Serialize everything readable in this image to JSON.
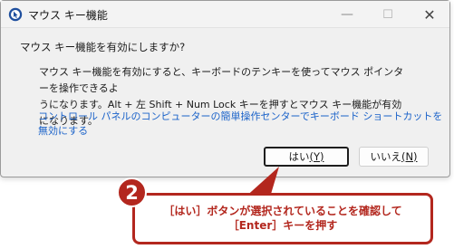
{
  "window": {
    "title": "マウス キー機能",
    "controls": {
      "minimize": "—",
      "maximize": "☐",
      "close": "✕"
    },
    "icon": "mouse-keys-app-icon"
  },
  "dialog": {
    "question": "マウス キー機能を有効にしますか?",
    "description": "マウス キー機能を有効にすると、キーボードのテンキーを使ってマウス ポインターを操作できるよ\nうになります。Alt + 左 Shift + Num Lock キーを押すとマウス キー機能が有効になります。",
    "link": "コントロール パネルのコンピューターの簡単操作センターでキーボード ショートカットを無効にする",
    "buttons": {
      "yes": {
        "label": "はい",
        "accel": "(Y)"
      },
      "no": {
        "label": "いいえ",
        "accel": "(N)"
      }
    }
  },
  "annotation": {
    "badge_number": "2",
    "text": "［はい］ボタンが選択されていることを確認して\n［Enter］キーを押す",
    "color": "#b3271e"
  },
  "colors": {
    "link": "#1a62c9",
    "dialog_bg": "#f0f0f0",
    "accent": "#b3271e"
  }
}
